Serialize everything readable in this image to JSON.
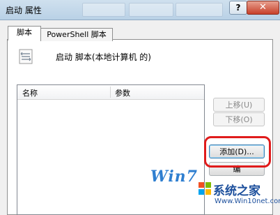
{
  "window": {
    "title": "启动 属性",
    "help_glyph": "?",
    "close_glyph": "✕"
  },
  "tabs": [
    {
      "label": "脚本"
    },
    {
      "label": "PowerShell 脚本"
    }
  ],
  "panel": {
    "heading": "启动 脚本(本地计算机 的)",
    "columns": [
      "名称",
      "参数"
    ]
  },
  "buttons": {
    "up": "上移(U)",
    "down": "下移(O)",
    "add": "添加(D)...",
    "edit": "编"
  },
  "watermark": {
    "logo": "Win7",
    "site": "系统之家",
    "url": "Www.Win10net.com"
  },
  "colors": {
    "highlight_ring": "#e01b1b",
    "close_button": "#c7402a"
  }
}
